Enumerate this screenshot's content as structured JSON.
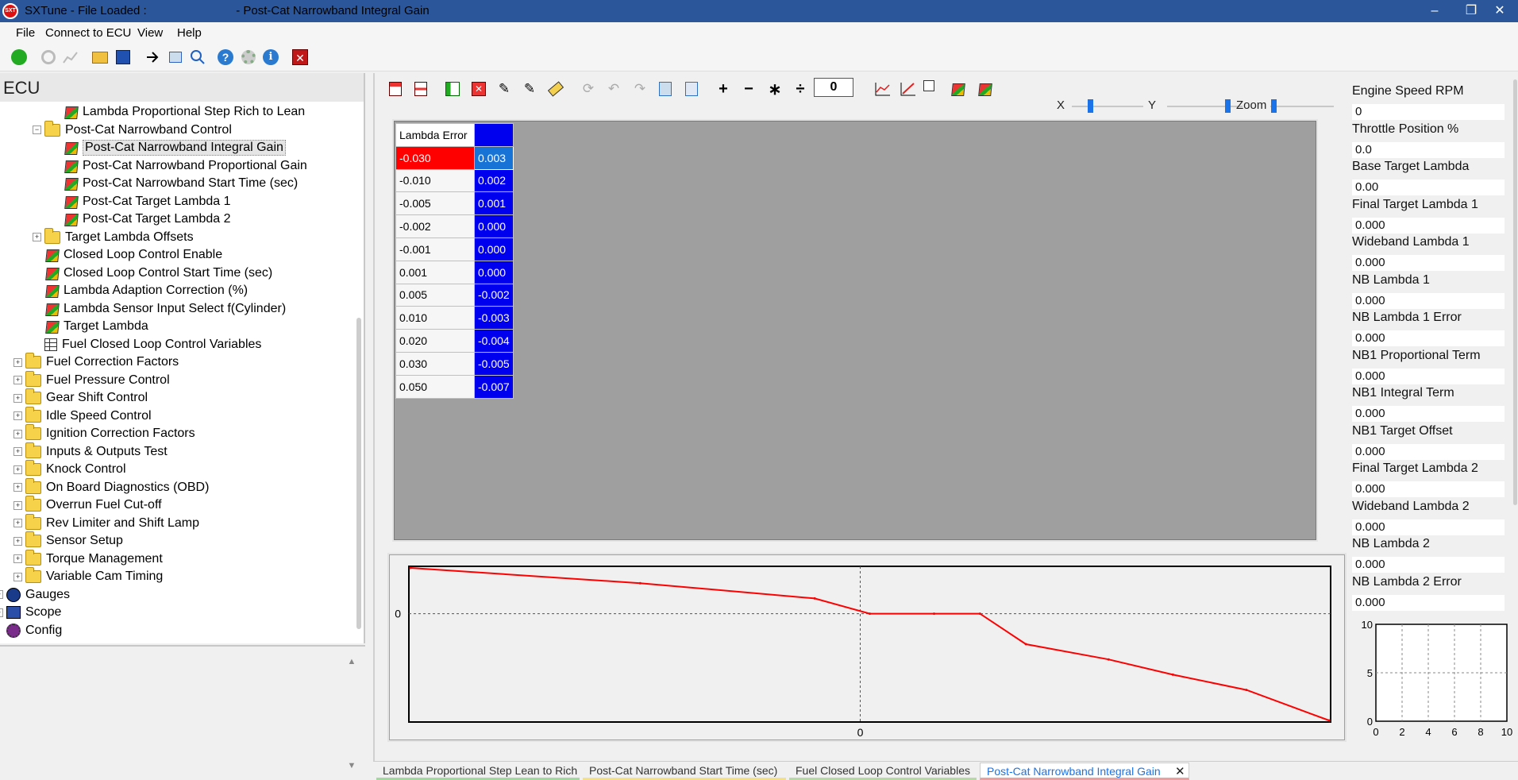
{
  "window": {
    "app_icon": "SXT",
    "title": "SXTune - File Loaded :                           - Post-Cat Narrowband Integral Gain",
    "min": "–",
    "restore": "❐",
    "close": "✕"
  },
  "menu": {
    "items": [
      "File",
      "Connect to ECU",
      "View",
      "Help"
    ]
  },
  "toolbar_icons": [
    "power-icon",
    "disconnect-icon",
    "chart-disabled-icon",
    "open-folder-icon",
    "save-icon",
    "goto-icon",
    "copy-icon",
    "search-icon",
    "help-icon",
    "settings-icon",
    "info-icon",
    "close-red-icon"
  ],
  "left": {
    "header": "ECU",
    "tree": [
      {
        "label": "Lambda Proportional Step Rich to Lean",
        "icon": "cube",
        "indent": 2
      },
      {
        "label": "Post-Cat Narrowband Control",
        "icon": "folder",
        "indent": 1,
        "exp": "−"
      },
      {
        "label": "Post-Cat Narrowband Integral Gain",
        "icon": "cube",
        "indent": 2,
        "selected": true
      },
      {
        "label": "Post-Cat Narrowband Proportional Gain",
        "icon": "cube",
        "indent": 2
      },
      {
        "label": "Post-Cat Narrowband Start Time (sec)",
        "icon": "cube",
        "indent": 2
      },
      {
        "label": "Post-Cat Target Lambda 1",
        "icon": "cube",
        "indent": 2
      },
      {
        "label": "Post-Cat Target Lambda 2",
        "icon": "cube",
        "indent": 2
      },
      {
        "label": "Target Lambda Offsets",
        "icon": "folder",
        "indent": 1,
        "exp": "+"
      },
      {
        "label": "Closed Loop Control Enable",
        "icon": "cube",
        "indent": 1
      },
      {
        "label": "Closed Loop Control Start Time (sec)",
        "icon": "cube",
        "indent": 1
      },
      {
        "label": "Lambda Adaption Correction (%)",
        "icon": "cube",
        "indent": 1
      },
      {
        "label": "Lambda Sensor Input Select f(Cylinder)",
        "icon": "cube",
        "indent": 1
      },
      {
        "label": "Target Lambda",
        "icon": "cube",
        "indent": 1
      },
      {
        "label": "Fuel Closed Loop Control Variables",
        "icon": "grid",
        "indent": 1
      },
      {
        "label": "Fuel Correction Factors",
        "icon": "folder",
        "indent": 0,
        "exp": "+"
      },
      {
        "label": "Fuel Pressure Control",
        "icon": "folder",
        "indent": 0,
        "exp": "+"
      },
      {
        "label": "Gear Shift Control",
        "icon": "folder",
        "indent": 0,
        "exp": "+"
      },
      {
        "label": "Idle Speed Control",
        "icon": "folder",
        "indent": 0,
        "exp": "+"
      },
      {
        "label": "Ignition Correction Factors",
        "icon": "folder",
        "indent": 0,
        "exp": "+"
      },
      {
        "label": "Inputs & Outputs Test",
        "icon": "folder",
        "indent": 0,
        "exp": "+"
      },
      {
        "label": "Knock Control",
        "icon": "folder",
        "indent": 0,
        "exp": "+"
      },
      {
        "label": "On Board Diagnostics (OBD)",
        "icon": "folder",
        "indent": 0,
        "exp": "+"
      },
      {
        "label": "Overrun Fuel Cut-off",
        "icon": "folder",
        "indent": 0,
        "exp": "+"
      },
      {
        "label": "Rev Limiter and Shift Lamp",
        "icon": "folder",
        "indent": 0,
        "exp": "+"
      },
      {
        "label": "Sensor Setup",
        "icon": "folder",
        "indent": 0,
        "exp": "+"
      },
      {
        "label": "Torque Management",
        "icon": "folder",
        "indent": 0,
        "exp": "+"
      },
      {
        "label": "Variable Cam Timing",
        "icon": "folder",
        "indent": 0,
        "exp": "+"
      },
      {
        "label": "Gauges",
        "icon": "gauge",
        "indent": -1,
        "exp": "+"
      },
      {
        "label": "Scope",
        "icon": "scope",
        "indent": -1,
        "exp": "+"
      },
      {
        "label": "Config",
        "icon": "config",
        "indent": -1
      }
    ],
    "scroll_up": "▲",
    "scroll_down": "▼"
  },
  "editor": {
    "toolbar_icons": [
      "insert-row-icon",
      "delete-row-icon",
      "insert-col-icon",
      "delete-col-icon",
      "edit-icon",
      "edit-multi-icon",
      "eraser-icon",
      "refresh-icon",
      "undo-icon",
      "redo-icon",
      "copy-icon",
      "paste-icon",
      "plus-icon",
      "minus-icon",
      "multiply-icon",
      "divide-icon"
    ],
    "op_symbols": [
      "+",
      "−",
      "∗",
      "÷"
    ],
    "operand_value": "0",
    "slider_x_label": "X",
    "slider_y_label": "Y",
    "slider_zoom_label": "Zoom",
    "slider_x_level": 0.25,
    "slider_y_level": 0.8,
    "slider_zoom_level": 0.05,
    "table_header": "Lambda Error",
    "rows": [
      {
        "x": "-0.030",
        "v": "0.003"
      },
      {
        "x": "-0.010",
        "v": "0.002"
      },
      {
        "x": "-0.005",
        "v": "0.001"
      },
      {
        "x": "-0.002",
        "v": "0.000"
      },
      {
        "x": "-0.001",
        "v": "0.000"
      },
      {
        "x": "0.001",
        "v": "0.000"
      },
      {
        "x": "0.005",
        "v": "-0.002"
      },
      {
        "x": "0.010",
        "v": "-0.003"
      },
      {
        "x": "0.020",
        "v": "-0.004"
      },
      {
        "x": "0.030",
        "v": "-0.005"
      },
      {
        "x": "0.050",
        "v": "-0.007"
      }
    ]
  },
  "chart_data": [
    {
      "type": "line",
      "x_index": [
        0,
        1,
        2,
        3,
        4,
        5,
        6,
        7,
        8,
        9,
        10
      ],
      "series": [
        {
          "values": [
            0.003,
            0.002,
            0.001,
            0.0,
            0.0,
            0.0,
            -0.002,
            -0.003,
            -0.004,
            -0.005,
            -0.007
          ]
        }
      ],
      "y_axis_label": "0",
      "x_axis_label": "0",
      "line_color": "#ff0000"
    },
    {
      "type": "line",
      "x_ticks": [
        "0",
        "2",
        "4",
        "6",
        "8",
        "10"
      ],
      "y_ticks": [
        "0",
        "5",
        "10"
      ],
      "xlim": [
        0,
        10
      ],
      "ylim": [
        0,
        10
      ],
      "grid": true,
      "series": []
    }
  ],
  "tabs": [
    {
      "label": "Lambda Proportional Step Lean to Rich",
      "color": "#a3d8a0"
    },
    {
      "label": "Post-Cat Narrowband Start Time (sec)",
      "color": "#f2e08a"
    },
    {
      "label": "Fuel Closed Loop Control Variables",
      "color": "#b8d8a8"
    },
    {
      "label": "Post-Cat Narrowband Integral Gain",
      "color": "#e8a0a0",
      "active": true
    }
  ],
  "tab_close": "✕",
  "gauges": [
    {
      "label": "Engine Speed RPM",
      "value": "0"
    },
    {
      "label": "Throttle Position %",
      "value": "0.0"
    },
    {
      "label": "Base Target Lambda",
      "value": "0.00"
    },
    {
      "label": "Final Target Lambda 1",
      "value": "0.000"
    },
    {
      "label": "Wideband Lambda 1",
      "value": "0.000"
    },
    {
      "label": "NB Lambda 1",
      "value": "0.000"
    },
    {
      "label": "NB Lambda 1 Error",
      "value": "0.000"
    },
    {
      "label": "NB1 Proportional Term",
      "value": "0.000"
    },
    {
      "label": "NB1 Integral Term",
      "value": "0.000"
    },
    {
      "label": "NB1 Target Offset",
      "value": "0.000"
    },
    {
      "label": "Final Target Lambda 2",
      "value": "0.000"
    },
    {
      "label": "Wideband Lambda 2",
      "value": "0.000"
    },
    {
      "label": "NB Lambda 2",
      "value": "0.000"
    },
    {
      "label": "NB Lambda 2 Error",
      "value": "0.000"
    }
  ]
}
